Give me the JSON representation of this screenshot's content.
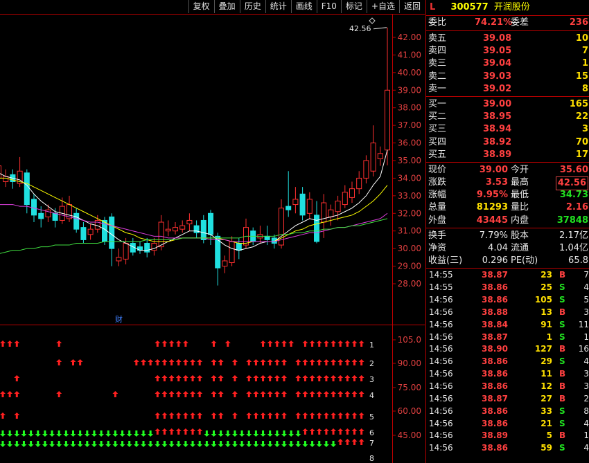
{
  "toolbar": [
    "复权",
    "叠加",
    "历史",
    "统计",
    "画线",
    "F10",
    "标记",
    "+自选",
    "返回"
  ],
  "header": {
    "market": "L",
    "code": "300577",
    "name": "开润股份"
  },
  "weibi": {
    "label1": "委比",
    "value1": "74.21%",
    "label2": "委差",
    "value2": "236"
  },
  "asks": [
    {
      "label": "卖五",
      "price": "39.08",
      "vol": "10"
    },
    {
      "label": "卖四",
      "price": "39.05",
      "vol": "7"
    },
    {
      "label": "卖三",
      "price": "39.04",
      "vol": "1"
    },
    {
      "label": "卖二",
      "price": "39.03",
      "vol": "15"
    },
    {
      "label": "卖一",
      "price": "39.02",
      "vol": "8"
    }
  ],
  "bids": [
    {
      "label": "买一",
      "price": "39.00",
      "vol": "165"
    },
    {
      "label": "买二",
      "price": "38.95",
      "vol": "22"
    },
    {
      "label": "买三",
      "price": "38.94",
      "vol": "3"
    },
    {
      "label": "买四",
      "price": "38.92",
      "vol": "70"
    },
    {
      "label": "买五",
      "price": "38.89",
      "vol": "17"
    }
  ],
  "quote": [
    {
      "l1": "现价",
      "v1": "39.00",
      "c1": "red",
      "l2": "今开",
      "v2": "35.60",
      "c2": "red"
    },
    {
      "l1": "涨跌",
      "v1": "3.53",
      "c1": "red",
      "l2": "最高",
      "v2": "42.56",
      "c2": "red",
      "box2": true
    },
    {
      "l1": "涨幅",
      "v1": "9.95%",
      "c1": "red",
      "l2": "最低",
      "v2": "34.73",
      "c2": "grn"
    },
    {
      "l1": "总量",
      "v1": "81293",
      "c1": "yel",
      "l2": "量比",
      "v2": "2.16",
      "c2": "red"
    },
    {
      "l1": "外盘",
      "v1": "43445",
      "c1": "red",
      "l2": "内盘",
      "v2": "37848",
      "c2": "grn"
    }
  ],
  "fundamentals": [
    {
      "l1": "换手",
      "v1": "7.79%",
      "l2": "股本",
      "v2": "2.17亿"
    },
    {
      "l1": "净资",
      "v1": "4.04",
      "l2": "流通",
      "v2": "1.04亿"
    },
    {
      "l1": "收益(三)",
      "v1": "0.296",
      "l2": "PE(动)",
      "v2": "65.8"
    }
  ],
  "ticks": [
    {
      "time": "14:55",
      "price": "38.87",
      "pc": "red",
      "vol": "23",
      "bs": "B",
      "n": "7"
    },
    {
      "time": "14:55",
      "price": "38.86",
      "pc": "red",
      "vol": "25",
      "bs": "S",
      "n": "4"
    },
    {
      "time": "14:56",
      "price": "38.86",
      "pc": "red",
      "vol": "105",
      "bs": "S",
      "n": "5"
    },
    {
      "time": "14:56",
      "price": "38.88",
      "pc": "red",
      "vol": "13",
      "bs": "B",
      "n": "3"
    },
    {
      "time": "14:56",
      "price": "38.84",
      "pc": "red",
      "vol": "91",
      "bs": "S",
      "n": "11"
    },
    {
      "time": "14:56",
      "price": "38.87",
      "pc": "red",
      "vol": "1",
      "bs": "S",
      "n": "1"
    },
    {
      "time": "14:56",
      "price": "38.90",
      "pc": "red",
      "vol": "127",
      "bs": "B",
      "n": "16"
    },
    {
      "time": "14:56",
      "price": "38.86",
      "pc": "red",
      "vol": "29",
      "bs": "S",
      "n": "4"
    },
    {
      "time": "14:56",
      "price": "38.86",
      "pc": "red",
      "vol": "11",
      "bs": "B",
      "n": "3"
    },
    {
      "time": "14:56",
      "price": "38.86",
      "pc": "red",
      "vol": "12",
      "bs": "B",
      "n": "3"
    },
    {
      "time": "14:56",
      "price": "38.87",
      "pc": "red",
      "vol": "27",
      "bs": "B",
      "n": "2"
    },
    {
      "time": "14:56",
      "price": "38.86",
      "pc": "red",
      "vol": "33",
      "bs": "S",
      "n": "8"
    },
    {
      "time": "14:56",
      "price": "38.86",
      "pc": "red",
      "vol": "21",
      "bs": "S",
      "n": "4"
    },
    {
      "time": "14:56",
      "price": "38.89",
      "pc": "red",
      "vol": "5",
      "bs": "B",
      "n": "1"
    },
    {
      "time": "14:56",
      "price": "38.86",
      "pc": "red",
      "vol": "59",
      "bs": "S",
      "n": "4"
    }
  ],
  "chart_data": {
    "type": "candlestick",
    "y_axis_ticks": [
      "42.00",
      "41.00",
      "40.00",
      "39.00",
      "38.00",
      "37.00",
      "36.00",
      "35.00",
      "34.00",
      "33.00",
      "32.00",
      "31.00",
      "30.00",
      "29.00",
      "28.00"
    ],
    "max_label": "42.56",
    "event_marker": "财",
    "candles": [
      {
        "o": 34.0,
        "c": 34.7,
        "h": 35.0,
        "l": 33.3
      },
      {
        "o": 33.8,
        "c": 34.1,
        "h": 34.5,
        "l": 33.5
      },
      {
        "o": 34.2,
        "c": 33.8,
        "h": 34.5,
        "l": 33.4
      },
      {
        "o": 33.7,
        "c": 34.4,
        "h": 35.2,
        "l": 33.5
      },
      {
        "o": 34.3,
        "c": 32.5,
        "h": 34.5,
        "l": 32.0
      },
      {
        "o": 32.8,
        "c": 31.9,
        "h": 33.1,
        "l": 31.5
      },
      {
        "o": 32.0,
        "c": 31.7,
        "h": 32.4,
        "l": 31.2
      },
      {
        "o": 31.8,
        "c": 32.2,
        "h": 32.5,
        "l": 31.5
      },
      {
        "o": 32.0,
        "c": 31.6,
        "h": 32.3,
        "l": 31.2
      },
      {
        "o": 31.6,
        "c": 32.4,
        "h": 32.9,
        "l": 31.4
      },
      {
        "o": 31.7,
        "c": 32.5,
        "h": 33.0,
        "l": 31.5
      },
      {
        "o": 32.0,
        "c": 31.1,
        "h": 32.3,
        "l": 30.9
      },
      {
        "o": 31.2,
        "c": 30.5,
        "h": 31.5,
        "l": 30.3
      },
      {
        "o": 30.8,
        "c": 31.1,
        "h": 31.4,
        "l": 30.5
      },
      {
        "o": 31.1,
        "c": 31.6,
        "h": 31.9,
        "l": 30.9
      },
      {
        "o": 31.6,
        "c": 30.4,
        "h": 31.8,
        "l": 30.2
      },
      {
        "o": 31.8,
        "c": 30.0,
        "h": 32.0,
        "l": 29.0
      },
      {
        "o": 29.3,
        "c": 29.5,
        "h": 30.0,
        "l": 29.0
      },
      {
        "o": 29.4,
        "c": 30.3,
        "h": 30.6,
        "l": 29.1
      },
      {
        "o": 30.3,
        "c": 29.8,
        "h": 30.6,
        "l": 29.6
      },
      {
        "o": 30.1,
        "c": 29.9,
        "h": 30.4,
        "l": 29.7
      },
      {
        "o": 30.3,
        "c": 29.8,
        "h": 30.6,
        "l": 29.5
      },
      {
        "o": 29.9,
        "c": 30.3,
        "h": 30.6,
        "l": 29.6
      },
      {
        "o": 30.1,
        "c": 31.5,
        "h": 31.9,
        "l": 29.9
      },
      {
        "o": 31.0,
        "c": 31.1,
        "h": 31.6,
        "l": 30.7
      },
      {
        "o": 31.0,
        "c": 31.2,
        "h": 31.5,
        "l": 30.8
      },
      {
        "o": 31.1,
        "c": 31.3,
        "h": 31.6,
        "l": 30.9
      },
      {
        "o": 31.4,
        "c": 31.6,
        "h": 32.0,
        "l": 31.0
      },
      {
        "o": 31.3,
        "c": 30.9,
        "h": 31.6,
        "l": 30.6
      },
      {
        "o": 31.6,
        "c": 30.5,
        "h": 31.9,
        "l": 30.3
      },
      {
        "o": 32.0,
        "c": 30.8,
        "h": 32.2,
        "l": 30.2
      },
      {
        "o": 30.7,
        "c": 28.9,
        "h": 30.9,
        "l": 27.9
      },
      {
        "o": 29.0,
        "c": 29.3,
        "h": 29.6,
        "l": 28.6
      },
      {
        "o": 29.2,
        "c": 30.4,
        "h": 30.7,
        "l": 29.0
      },
      {
        "o": 30.3,
        "c": 29.9,
        "h": 30.6,
        "l": 29.4
      },
      {
        "o": 30.2,
        "c": 31.2,
        "h": 31.7,
        "l": 30.0
      },
      {
        "o": 31.0,
        "c": 30.4,
        "h": 31.2,
        "l": 30.2
      },
      {
        "o": 30.6,
        "c": 30.8,
        "h": 31.3,
        "l": 30.3
      },
      {
        "o": 30.7,
        "c": 30.5,
        "h": 31.3,
        "l": 30.2
      },
      {
        "o": 30.6,
        "c": 30.3,
        "h": 30.8,
        "l": 30.0
      },
      {
        "o": 30.2,
        "c": 32.3,
        "h": 32.8,
        "l": 30.0
      },
      {
        "o": 32.4,
        "c": 32.2,
        "h": 34.4,
        "l": 31.8
      },
      {
        "o": 32.5,
        "c": 32.8,
        "h": 33.5,
        "l": 32.0
      },
      {
        "o": 33.1,
        "c": 31.9,
        "h": 33.5,
        "l": 31.6
      },
      {
        "o": 32.0,
        "c": 32.8,
        "h": 33.2,
        "l": 31.7
      },
      {
        "o": 31.9,
        "c": 30.4,
        "h": 32.7,
        "l": 30.3
      },
      {
        "o": 31.5,
        "c": 32.6,
        "h": 33.1,
        "l": 30.6
      },
      {
        "o": 31.8,
        "c": 32.2,
        "h": 32.5,
        "l": 31.3
      },
      {
        "o": 32.1,
        "c": 32.7,
        "h": 33.0,
        "l": 31.6
      },
      {
        "o": 32.5,
        "c": 33.2,
        "h": 33.6,
        "l": 32.3
      },
      {
        "o": 32.9,
        "c": 33.4,
        "h": 33.8,
        "l": 32.6
      },
      {
        "o": 33.4,
        "c": 34.0,
        "h": 34.4,
        "l": 33.1
      },
      {
        "o": 34.0,
        "c": 35.0,
        "h": 35.3,
        "l": 33.7
      },
      {
        "o": 34.4,
        "c": 36.0,
        "h": 37.0,
        "l": 34.1
      },
      {
        "o": 35.1,
        "c": 35.4,
        "h": 35.8,
        "l": 34.7
      },
      {
        "o": 35.6,
        "c": 39.0,
        "h": 42.56,
        "l": 34.73
      }
    ],
    "ma": [
      {
        "color": "#ffffff",
        "values": [
          34.3,
          34.1,
          34.0,
          33.9,
          33.6,
          33.1,
          32.7,
          32.4,
          32.1,
          32.0,
          31.9,
          31.8,
          31.6,
          31.4,
          31.3,
          31.1,
          30.8,
          30.5,
          30.3,
          30.1,
          29.9,
          29.9,
          30.0,
          30.2,
          30.4,
          30.6,
          30.8,
          31.0,
          31.0,
          30.9,
          30.8,
          30.5,
          30.2,
          30.0,
          29.9,
          30.0,
          30.1,
          30.3,
          30.4,
          30.4,
          30.7,
          31.0,
          31.3,
          31.5,
          31.7,
          31.6,
          31.7,
          31.8,
          31.9,
          32.1,
          32.3,
          32.6,
          33.0,
          33.6,
          34.1,
          35.6
        ]
      },
      {
        "color": "#ffff00",
        "values": [
          34.0,
          34.0,
          33.9,
          33.8,
          33.7,
          33.5,
          33.3,
          33.1,
          32.9,
          32.7,
          32.5,
          32.3,
          32.1,
          31.9,
          31.7,
          31.5,
          31.3,
          31.1,
          30.9,
          30.8,
          30.6,
          30.5,
          30.4,
          30.4,
          30.4,
          30.5,
          30.6,
          30.6,
          30.6,
          30.6,
          30.6,
          30.6,
          30.5,
          30.4,
          30.3,
          30.3,
          30.4,
          30.4,
          30.4,
          30.4,
          30.6,
          30.8,
          31.0,
          31.1,
          31.3,
          31.4,
          31.5,
          31.6,
          31.7,
          31.8,
          31.9,
          32.1,
          32.4,
          32.7,
          33.1,
          33.6
        ]
      },
      {
        "color": "#e040e0",
        "values": [
          32.5,
          32.5,
          32.5,
          32.4,
          32.4,
          32.3,
          32.2,
          32.1,
          32.0,
          31.9,
          31.8,
          31.7,
          31.6,
          31.5,
          31.5,
          31.4,
          31.3,
          31.2,
          31.1,
          31.0,
          30.9,
          30.8,
          30.7,
          30.7,
          30.6,
          30.6,
          30.6,
          30.6,
          30.6,
          30.6,
          30.5,
          30.5,
          30.5,
          30.4,
          30.4,
          30.4,
          30.4,
          30.4,
          30.4,
          30.4,
          30.5,
          30.6,
          30.7,
          30.8,
          30.9,
          30.9,
          31.0,
          31.1,
          31.2,
          31.2,
          31.3,
          31.4,
          31.5,
          31.6,
          31.7,
          32.0
        ]
      },
      {
        "color": "#40e040",
        "values": [
          29.7,
          29.8,
          29.9,
          29.9,
          30.0,
          30.0,
          30.1,
          30.1,
          30.2,
          30.2,
          30.2,
          30.3,
          30.3,
          30.3,
          30.3,
          30.4,
          30.4,
          30.4,
          30.4,
          30.4,
          30.4,
          30.5,
          30.5,
          30.5,
          30.5,
          30.5,
          30.6,
          30.6,
          30.6,
          30.6,
          30.6,
          30.6,
          30.6,
          30.6,
          30.6,
          30.7,
          30.7,
          30.7,
          30.7,
          30.7,
          30.8,
          30.8,
          30.9,
          30.9,
          31.0,
          31.0,
          31.1,
          31.1,
          31.2,
          31.2,
          31.3,
          31.3,
          31.4,
          31.5,
          31.6,
          31.7
        ]
      }
    ],
    "indicator_axis": [
      "105.0",
      "90.00",
      "75.00",
      "60.00",
      "45.00"
    ],
    "indicator_rows": [
      {
        "label": "1",
        "signals": "1110000010000000000000111110001010000111110111111111"
      },
      {
        "label": "2",
        "signals": "0000000010110000000111111111101101011111101111111111"
      },
      {
        "label": "3",
        "signals": "0010000000000000000000111111101101011111101111111111"
      },
      {
        "label": "4",
        "signals": "1110000010000000100000111111101101011111101111111111"
      },
      {
        "label": "5",
        "signals": "1010000000000000000000111111101101011111101111111111"
      },
      {
        "label": "6",
        "signals": "2222222222222222222222111111122222222222222111111111"
      },
      {
        "label": "7",
        "signals": "2222222222222222222222222222222222222222222222221111"
      },
      {
        "label": "8",
        "signals": ""
      }
    ]
  }
}
